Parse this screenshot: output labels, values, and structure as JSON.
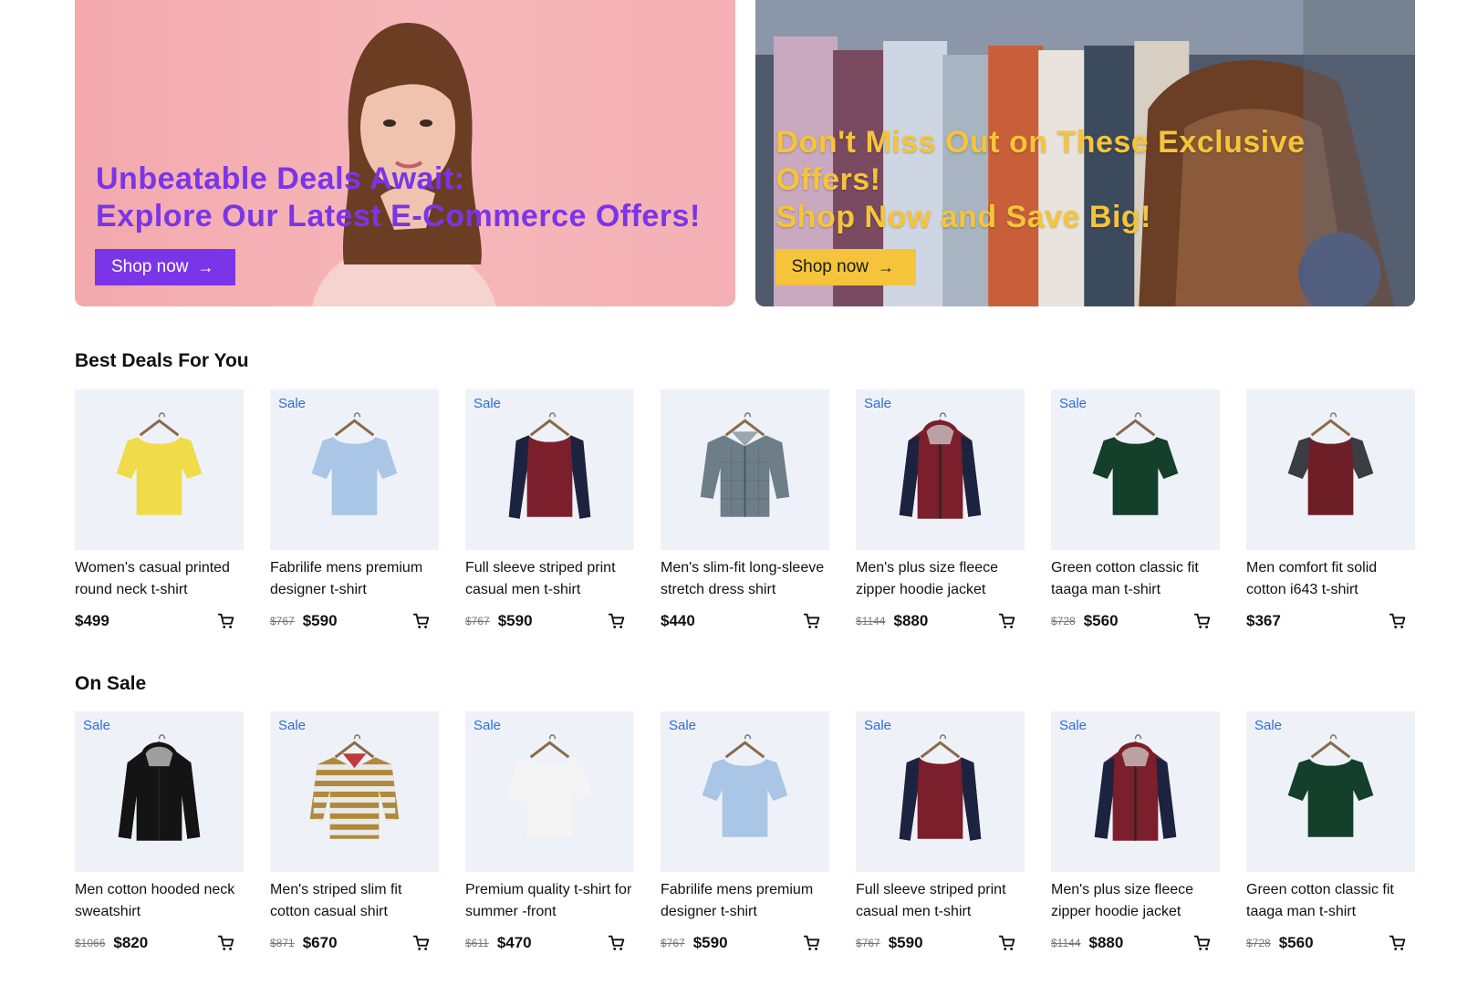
{
  "banners": [
    {
      "line1": "Unbeatable Deals Await:",
      "line2": "Explore Our Latest E-Commerce Offers!",
      "line3": "",
      "button": "Shop now",
      "accent": "#7b35e8"
    },
    {
      "line1": "Don't Miss Out on These Exclusive",
      "line2": "Offers!",
      "line3": "Shop Now and Save Big!",
      "button": "Shop now",
      "accent": "#f5c43a"
    }
  ],
  "sections": [
    {
      "title": "Best Deals For You",
      "products": [
        {
          "name": "Women's casual printed round neck t-shirt",
          "old_price": "",
          "price": "$499",
          "sale": "",
          "shirt": "tee",
          "color": "#f0dc4a",
          "sleeve": "#f0dc4a"
        },
        {
          "name": "Fabrilife mens premium designer t-shirt",
          "old_price": "$767",
          "price": "$590",
          "sale": "Sale",
          "shirt": "tee",
          "color": "#a9c6e6",
          "sleeve": "#a9c6e6"
        },
        {
          "name": "Full sleeve striped print casual men t-shirt",
          "old_price": "$767",
          "price": "$590",
          "sale": "Sale",
          "shirt": "long",
          "color": "#7a1f2b",
          "sleeve": "#1c2340"
        },
        {
          "name": "Men's slim-fit long-sleeve stretch dress shirt",
          "old_price": "",
          "price": "$440",
          "sale": "",
          "shirt": "shirt",
          "color": "#6d7e88",
          "sleeve": "#6d7e88"
        },
        {
          "name": "Men's plus size fleece zipper hoodie jacket",
          "old_price": "$1144",
          "price": "$880",
          "sale": "Sale",
          "shirt": "hoodie",
          "color": "#7a1f2b",
          "sleeve": "#1c2340"
        },
        {
          "name": "Green cotton classic fit taaga man t-shirt",
          "old_price": "$728",
          "price": "$560",
          "sale": "Sale",
          "shirt": "tee",
          "color": "#143f2a",
          "sleeve": "#143f2a"
        },
        {
          "name": "Men comfort fit solid cotton i643 t-shirt",
          "old_price": "",
          "price": "$367",
          "sale": "",
          "shirt": "tee",
          "color": "#6e1e26",
          "sleeve": "#3a3d42"
        }
      ]
    },
    {
      "title": "On Sale",
      "products": [
        {
          "name": "Men cotton hooded neck sweatshirt",
          "old_price": "$1066",
          "price": "$820",
          "sale": "Sale",
          "shirt": "hoodie",
          "color": "#141414",
          "sleeve": "#141414"
        },
        {
          "name": "Men's striped slim fit cotton casual shirt",
          "old_price": "$871",
          "price": "$670",
          "sale": "Sale",
          "shirt": "stripe",
          "color": "#b08a3a",
          "sleeve": "#b08a3a"
        },
        {
          "name": "Premium quality t-shirt for summer -front",
          "old_price": "$611",
          "price": "$470",
          "sale": "Sale",
          "shirt": "tee",
          "color": "#f4f4f4",
          "sleeve": "#f4f4f4"
        },
        {
          "name": "Fabrilife mens premium designer t-shirt",
          "old_price": "$767",
          "price": "$590",
          "sale": "Sale",
          "shirt": "tee",
          "color": "#a9c6e6",
          "sleeve": "#a9c6e6"
        },
        {
          "name": "Full sleeve striped print casual men t-shirt",
          "old_price": "$767",
          "price": "$590",
          "sale": "Sale",
          "shirt": "long",
          "color": "#7a1f2b",
          "sleeve": "#1c2340"
        },
        {
          "name": "Men's plus size fleece zipper hoodie jacket",
          "old_price": "$1144",
          "price": "$880",
          "sale": "Sale",
          "shirt": "hoodie",
          "color": "#7a1f2b",
          "sleeve": "#1c2340"
        },
        {
          "name": "Green cotton classic fit taaga man t-shirt",
          "old_price": "$728",
          "price": "$560",
          "sale": "Sale",
          "shirt": "tee",
          "color": "#143f2a",
          "sleeve": "#143f2a"
        }
      ]
    }
  ]
}
